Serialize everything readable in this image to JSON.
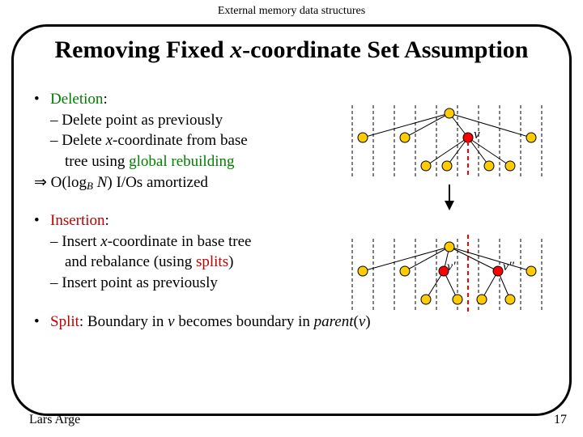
{
  "header": "External memory data structures",
  "title_a": "Removing Fixed ",
  "title_b": "x",
  "title_c": "-coordinate Set Assumption",
  "deletion": {
    "label": "Deletion",
    "line1": "– Delete point as previously",
    "line2a": "– Delete ",
    "line2b": "x",
    "line2c": "-coordinate from base",
    "line3a": "tree using ",
    "line3b": "global rebuilding",
    "result_suffix": "I/Os amortized"
  },
  "insertion": {
    "label": "Insertion",
    "line1a": "– Insert ",
    "line1b": "x",
    "line1c": "-coordinate in base tree",
    "line2a": "and rebalance (using ",
    "line2b": "splits",
    "line2c": ")",
    "line3": "– Insert point as previously"
  },
  "split": {
    "label": "Split",
    "rest_a": ": Boundary in ",
    "rest_b": "v",
    "rest_c": " becomes boundary in ",
    "rest_d": "parent",
    "rest_e": "(",
    "rest_f": "v",
    "rest_g": ")"
  },
  "labels": {
    "v": "v",
    "vp": "v'",
    "vpp": "v''"
  },
  "footer": {
    "author": "Lars Arge",
    "page": "17"
  }
}
